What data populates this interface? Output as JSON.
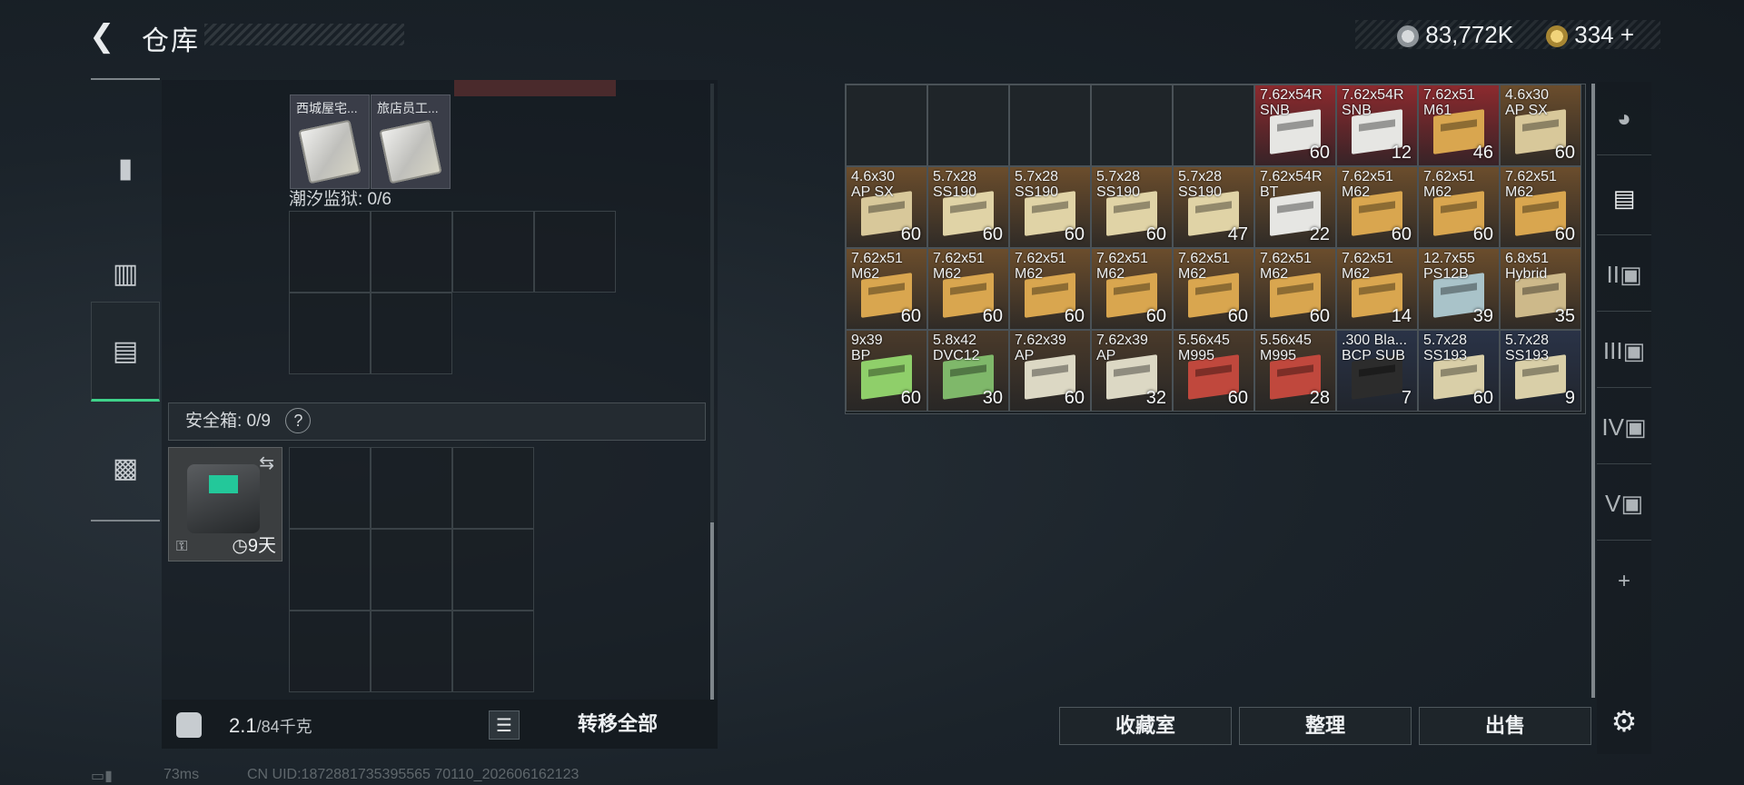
{
  "header": {
    "title": "仓库",
    "currency1": "83,772K",
    "currency2": "334",
    "plus": "+"
  },
  "left_nav": [
    "gun-icon",
    "armor-icon",
    "backpack-icon",
    "toolbox-icon"
  ],
  "left_panel": {
    "top_items": [
      {
        "label": "西城屋宅..."
      },
      {
        "label": "旅店员工..."
      }
    ],
    "prison_label": "潮汐监狱: 0/6",
    "safe_label": "安全箱: 0/9",
    "safe_help": "?",
    "safe_timer": "9天",
    "weight_value": "2.1",
    "weight_max": "/84千克",
    "move_all": "转移全部"
  },
  "status": {
    "ping": "73ms",
    "uid": "CN UID:1872881735395565 70110_202606162123"
  },
  "stash": {
    "rows": [
      [
        null,
        null,
        null,
        null,
        null,
        {
          "name": "7.62x54R\nSNB",
          "qty": "60",
          "color": "#8c2a2e",
          "box": "#e6e6e3"
        },
        {
          "name": "7.62x54R\nSNB",
          "qty": "12",
          "color": "#8c2a2e",
          "box": "#e6e6e3"
        },
        {
          "name": "7.62x51\nM61",
          "qty": "46",
          "color": "#8c2a2e",
          "box": "#d9a64f"
        },
        {
          "name": "4.6x30\nAP SX",
          "qty": "60",
          "color": "#6b4d2c",
          "box": "#d8c89a"
        }
      ],
      [
        {
          "name": "4.6x30\nAP SX",
          "qty": "60",
          "color": "#6b4d2c",
          "box": "#d8c89a"
        },
        {
          "name": "5.7x28\nSS190",
          "qty": "60",
          "color": "#6b4d2c",
          "box": "#e0d3a6"
        },
        {
          "name": "5.7x28\nSS190",
          "qty": "60",
          "color": "#6b4d2c",
          "box": "#e0d3a6"
        },
        {
          "name": "5.7x28\nSS190",
          "qty": "60",
          "color": "#6b4d2c",
          "box": "#e0d3a6"
        },
        {
          "name": "5.7x28\nSS190",
          "qty": "47",
          "color": "#6b4d2c",
          "box": "#e0d3a6"
        },
        {
          "name": "7.62x54R\nBT",
          "qty": "22",
          "color": "#6b4d2c",
          "box": "#e6e6e3"
        },
        {
          "name": "7.62x51\nM62",
          "qty": "60",
          "color": "#6b4d2c",
          "box": "#d9a64f"
        },
        {
          "name": "7.62x51\nM62",
          "qty": "60",
          "color": "#6b4d2c",
          "box": "#d9a64f"
        },
        {
          "name": "7.62x51\nM62",
          "qty": "60",
          "color": "#6b4d2c",
          "box": "#d9a64f"
        }
      ],
      [
        {
          "name": "7.62x51\nM62",
          "qty": "60",
          "color": "#6b4d2c",
          "box": "#d9a64f"
        },
        {
          "name": "7.62x51\nM62",
          "qty": "60",
          "color": "#6b4d2c",
          "box": "#d9a64f"
        },
        {
          "name": "7.62x51\nM62",
          "qty": "60",
          "color": "#6b4d2c",
          "box": "#d9a64f"
        },
        {
          "name": "7.62x51\nM62",
          "qty": "60",
          "color": "#6b4d2c",
          "box": "#d9a64f"
        },
        {
          "name": "7.62x51\nM62",
          "qty": "60",
          "color": "#6b4d2c",
          "box": "#d9a64f"
        },
        {
          "name": "7.62x51\nM62",
          "qty": "60",
          "color": "#6b4d2c",
          "box": "#d9a64f"
        },
        {
          "name": "7.62x51\nM62",
          "qty": "14",
          "color": "#6b4d2c",
          "box": "#d9a64f"
        },
        {
          "name": "12.7x55\nPS12B",
          "qty": "39",
          "color": "#6b4d2c",
          "box": "#a9c3c9"
        },
        {
          "name": "6.8x51\nHybrid",
          "qty": "35",
          "color": "#6b4d2c",
          "box": "#cdb98a"
        }
      ],
      [
        {
          "name": "9x39\nBP",
          "qty": "60",
          "color": "#4a3a2a",
          "box": "#8fcf6a"
        },
        {
          "name": "5.8x42\nDVC12",
          "qty": "30",
          "color": "#4a3a2a",
          "box": "#7fb86a"
        },
        {
          "name": "7.62x39\nAP",
          "qty": "60",
          "color": "#4a3a2a",
          "box": "#dcd8c4"
        },
        {
          "name": "7.62x39\nAP",
          "qty": "32",
          "color": "#4a3a2a",
          "box": "#dcd8c4"
        },
        {
          "name": "5.56x45\nM995",
          "qty": "60",
          "color": "#4a3a2a",
          "box": "#c0483d"
        },
        {
          "name": "5.56x45\nM995",
          "qty": "28",
          "color": "#4a3a2a",
          "box": "#c0483d"
        },
        {
          "name": ".300 Bla...\nBCP SUB",
          "qty": "7",
          "color": "#2a3347",
          "box": "#2c2c2c"
        },
        {
          "name": "5.7x28\nSS193",
          "qty": "60",
          "color": "#2a3347",
          "box": "#d9cfa8"
        },
        {
          "name": "5.7x28\nSS193",
          "qty": "9",
          "color": "#2a3347",
          "box": "#d9cfa8"
        }
      ]
    ]
  },
  "right_nav": [
    "helmet-icon",
    "stash-tab-1",
    "stash-tab-2",
    "stash-tab-3",
    "stash-tab-4",
    "stash-tab-5"
  ],
  "right_nav_labels": [
    "",
    "",
    "II",
    "III",
    "IV",
    "V"
  ],
  "right_nav_plus": "+",
  "buttons": {
    "collection": "收藏室",
    "sort": "整理",
    "sell": "出售"
  }
}
